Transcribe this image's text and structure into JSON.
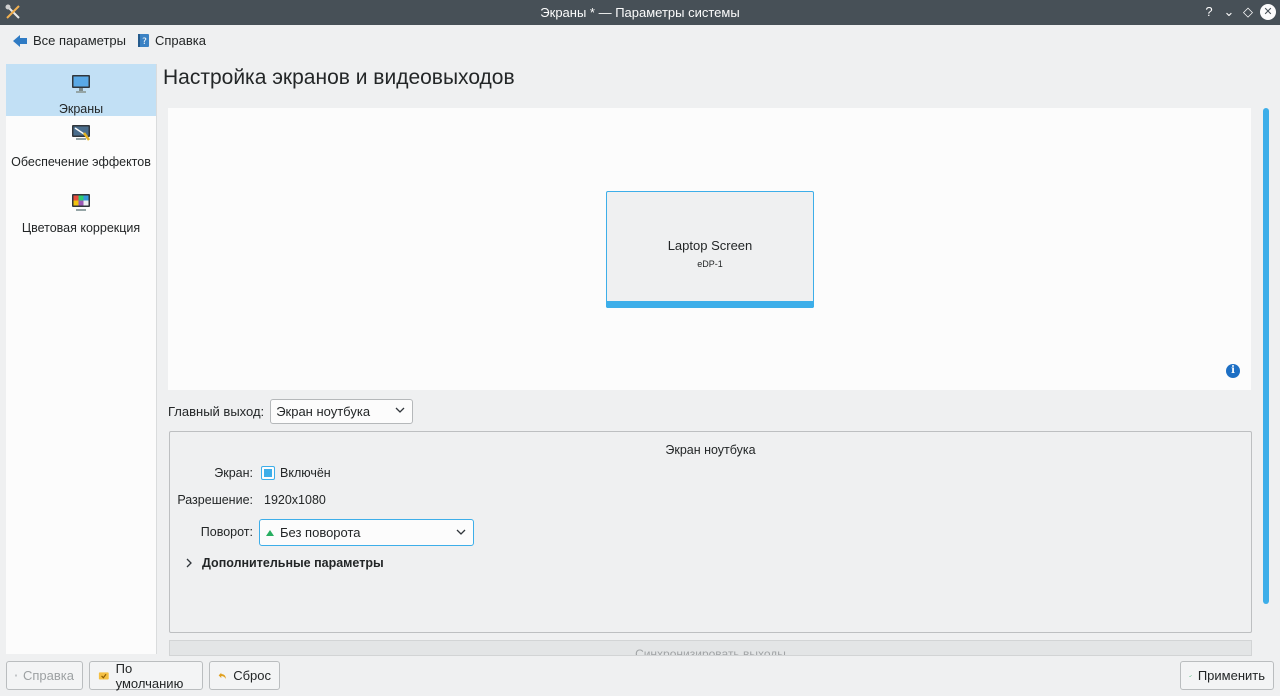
{
  "window": {
    "title": "Экраны * — Параметры системы",
    "help_glyph": "?",
    "min_glyph": "⌄",
    "max_glyph": "◇",
    "close_glyph": "✕"
  },
  "toolbar": {
    "all_settings_label": "Все параметры",
    "help_label": "Справка"
  },
  "sidebar": {
    "items": [
      {
        "label": "Экраны",
        "icon": "monitor-icon",
        "active": true
      },
      {
        "label": "Обеспечение эффектов",
        "icon": "compositor-icon",
        "active": false
      },
      {
        "label": "Цветовая коррекция",
        "icon": "color-correction-icon",
        "active": false
      }
    ]
  },
  "main": {
    "title": "Настройка экранов и видеовыходов",
    "preview": {
      "screen_name": "Laptop Screen",
      "screen_id": "eDP-1",
      "info_glyph": "i"
    },
    "primary_output": {
      "label": "Главный выход:",
      "value": "Экран ноутбука"
    },
    "output_group": {
      "title": "Экран ноутбука",
      "enabled_label": "Экран:",
      "enabled_value": "Включён",
      "enabled_checked": true,
      "resolution_label": "Разрешение:",
      "resolution_value": "1920x1080",
      "rotation_label": "Поворот:",
      "rotation_value": "Без поворота",
      "advanced_label": "Дополнительные параметры"
    },
    "sync_button_label": "Синхронизировать выходы"
  },
  "footer": {
    "help_label": "Справка",
    "defaults_label": "По умолчанию",
    "reset_label": "Сброс",
    "apply_label": "Применить"
  },
  "colors": {
    "accent": "#3daee9",
    "titlebar": "#475057",
    "selection": "#c2e0f5"
  }
}
